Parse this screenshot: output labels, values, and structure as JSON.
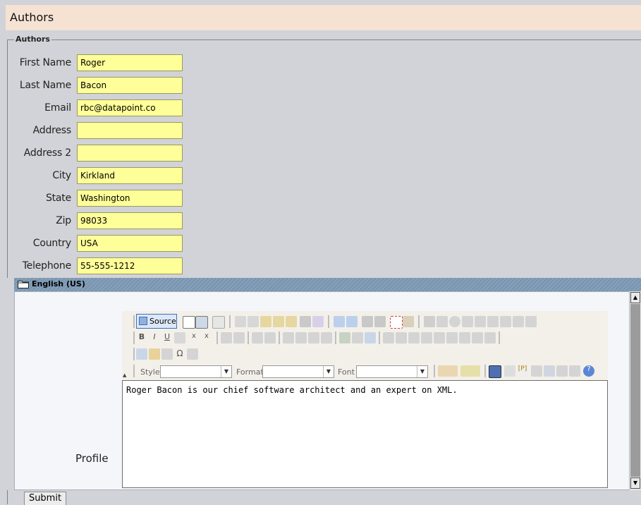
{
  "page": {
    "title": "Authors"
  },
  "fieldset": {
    "legend": "Authors"
  },
  "fields": [
    {
      "label": "First Name",
      "value": "Roger"
    },
    {
      "label": "Last Name",
      "value": "Bacon"
    },
    {
      "label": "Email",
      "value": "rbc@datapoint.co"
    },
    {
      "label": "Address",
      "value": ""
    },
    {
      "label": "Address 2",
      "value": ""
    },
    {
      "label": "City",
      "value": "Kirkland"
    },
    {
      "label": "State",
      "value": "Washington"
    },
    {
      "label": "Zip",
      "value": "98033"
    },
    {
      "label": "Country",
      "value": "USA"
    },
    {
      "label": "Telephone",
      "value": "55-555-1212"
    }
  ],
  "language_panel": {
    "title": "English (US)"
  },
  "profile": {
    "label": "Profile",
    "content": "Roger Bacon is our chief software architect and an expert on XML."
  },
  "editor_toolbar": {
    "source_label": "Source",
    "style_label": "Style",
    "format_label": "Format",
    "font_label": "Font"
  },
  "actions": {
    "submit_label": "Submit"
  },
  "colors": {
    "input_bg": "#ffff99",
    "header_bg": "#f5e2d2",
    "panel_bar": "#7e9ab6",
    "page_bg": "#d1d3d8"
  }
}
